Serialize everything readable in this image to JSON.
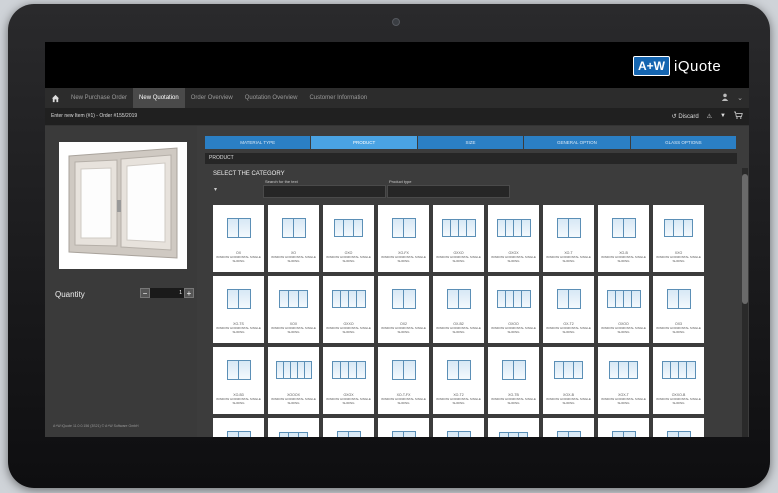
{
  "brand": {
    "logo_mark": "A+W",
    "product": "iQuote"
  },
  "nav": {
    "home_icon": "home-icon",
    "items": [
      {
        "label": "New Purchase Order",
        "active": false
      },
      {
        "label": "New Quotation",
        "active": true
      },
      {
        "label": "Order Overview",
        "active": false
      },
      {
        "label": "Quotation Overview",
        "active": false
      },
      {
        "label": "Customer Information",
        "active": false
      }
    ],
    "user_icon": "user-icon"
  },
  "subbar": {
    "title": "Enter new Item (#1) - Order #155/2019",
    "discard_label": "Discard",
    "icons": [
      "discard-icon",
      "warning-icon",
      "filter-icon",
      "cart-icon"
    ]
  },
  "left": {
    "quantity_label": "Quantity",
    "quantity_value": "1",
    "minus": "−",
    "plus": "+",
    "footer": "A+W iQuote 11.0.0.156 (3S21) © A+W Software GmbH"
  },
  "wizard": {
    "steps": [
      {
        "label": "MATERIAL TYPE",
        "active": false
      },
      {
        "label": "PRODUCT",
        "active": true
      },
      {
        "label": "SIZE",
        "active": false
      },
      {
        "label": "GENERAL OPTION",
        "active": false
      },
      {
        "label": "GLASS OPTIONS",
        "active": false
      }
    ]
  },
  "product": {
    "section_title": "PRODUCT",
    "select_title": "SELECT THE CATEGORY",
    "search_label": "Search for the text",
    "type_label": "Product type",
    "tiles": [
      {
        "code": "OX",
        "desc": "WINDOW HORIZONTAL SINGLE SLIDING",
        "panes": 2
      },
      {
        "code": "XO",
        "desc": "WINDOW HORIZONTAL SINGLE SLIDING",
        "panes": 2
      },
      {
        "code": "OXO",
        "desc": "WINDOW HORIZONTAL SINGLE SLIDING",
        "panes": 3
      },
      {
        "code": "XO-FX",
        "desc": "WINDOW HORIZONTAL SINGLE SLIDING",
        "panes": 2
      },
      {
        "code": "OXXO",
        "desc": "WINDOW HORIZONTAL SINGLE SLIDING",
        "panes": 4
      },
      {
        "code": "OXOX",
        "desc": "WINDOW HORIZONTAL SINGLE SLIDING",
        "panes": 4
      },
      {
        "code": "XO-T",
        "desc": "WINDOW HORIZONTAL SINGLE SLIDING",
        "panes": 2
      },
      {
        "code": "XO-B",
        "desc": "WINDOW HORIZONTAL SINGLE SLIDING",
        "panes": 2
      },
      {
        "code": "XXO",
        "desc": "WINDOW HORIZONTAL SINGLE SLIDING",
        "panes": 3
      },
      {
        "code": "XO-TS",
        "desc": "WINDOW HORIZONTAL SINGLE SLIDING",
        "panes": 2
      },
      {
        "code": "XOX",
        "desc": "WINDOW HORIZONTAL SINGLE SLIDING",
        "panes": 3
      },
      {
        "code": "OXXO",
        "desc": "WINDOW HORIZONTAL SINGLE SLIDING",
        "panes": 4
      },
      {
        "code": "OX2",
        "desc": "WINDOW HORIZONTAL SINGLE SLIDING",
        "panes": 2
      },
      {
        "code": "OX-B2",
        "desc": "WINDOW HORIZONTAL SINGLE SLIDING",
        "panes": 2
      },
      {
        "code": "OXOO",
        "desc": "WINDOW HORIZONTAL SINGLE SLIDING",
        "panes": 4
      },
      {
        "code": "OX-T2",
        "desc": "WINDOW HORIZONTAL SINGLE SLIDING",
        "panes": 2
      },
      {
        "code": "OXOO",
        "desc": "WINDOW HORIZONTAL SINGLE SLIDING",
        "panes": 4
      },
      {
        "code": "OX3",
        "desc": "WINDOW HORIZONTAL SINGLE SLIDING",
        "panes": 2
      },
      {
        "code": "XO-B3",
        "desc": "WINDOW HORIZONTAL SINGLE SLIDING",
        "panes": 2
      },
      {
        "code": "XOOOX",
        "desc": "WINDOW HORIZONTAL SINGLE SLIDING",
        "panes": 5
      },
      {
        "code": "OXOX",
        "desc": "WINDOW HORIZONTAL SINGLE SLIDING",
        "panes": 4
      },
      {
        "code": "XO-T-FX",
        "desc": "WINDOW HORIZONTAL SINGLE SLIDING",
        "panes": 2
      },
      {
        "code": "XO-T2",
        "desc": "WINDOW HORIZONTAL SINGLE SLIDING",
        "panes": 2
      },
      {
        "code": "XO-TB",
        "desc": "WINDOW HORIZONTAL SINGLE SLIDING",
        "panes": 2
      },
      {
        "code": "XOX-B",
        "desc": "WINDOW HORIZONTAL SINGLE SLIDING",
        "panes": 3
      },
      {
        "code": "XOX-T",
        "desc": "WINDOW HORIZONTAL SINGLE SLIDING",
        "panes": 3
      },
      {
        "code": "OXXO-B",
        "desc": "WINDOW HORIZONTAL SINGLE SLIDING",
        "panes": 4
      },
      {
        "code": "",
        "desc": "",
        "panes": 2
      },
      {
        "code": "",
        "desc": "",
        "panes": 3
      },
      {
        "code": "",
        "desc": "",
        "panes": 2
      },
      {
        "code": "",
        "desc": "",
        "panes": 2
      },
      {
        "code": "",
        "desc": "",
        "panes": 2
      },
      {
        "code": "",
        "desc": "",
        "panes": 3
      },
      {
        "code": "",
        "desc": "",
        "panes": 2
      },
      {
        "code": "",
        "desc": "",
        "panes": 2
      },
      {
        "code": "",
        "desc": "",
        "panes": 2
      }
    ]
  },
  "colors": {
    "accent": "#2b7fc4",
    "accent_active": "#4aa3e3",
    "logo_blue": "#1565b0"
  }
}
